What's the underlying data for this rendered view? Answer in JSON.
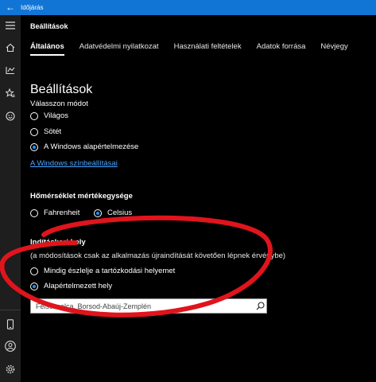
{
  "window": {
    "title": "Időjárás"
  },
  "header": {
    "title": "Beállítások"
  },
  "tabs": [
    {
      "label": "Általános"
    },
    {
      "label": "Adatvédelmi nyilatkozat"
    },
    {
      "label": "Használati feltételek"
    },
    {
      "label": "Adatok forrása"
    },
    {
      "label": "Névjegy"
    }
  ],
  "page": {
    "title": "Beállítások"
  },
  "mode": {
    "label": "Válasszon módot",
    "options": [
      {
        "label": "Világos",
        "checked": false
      },
      {
        "label": "Sötét",
        "checked": false
      },
      {
        "label": "A Windows alapértelmezése",
        "checked": true
      }
    ],
    "link": "A Windows színbeállításai"
  },
  "temperature": {
    "title": "Hőmérséklet mértékegysége",
    "options": [
      {
        "label": "Fahrenheit",
        "checked": false
      },
      {
        "label": "Celsius",
        "checked": true
      }
    ]
  },
  "launch": {
    "title": "Indításkori hely",
    "note": "(a módosítások csak az alkalmazás újraindítását követően lépnek érvénybe)",
    "options": [
      {
        "label": "Mindig észlelje a tartózkodási helyemet",
        "checked": false
      },
      {
        "label": "Alapértelmezett hely",
        "checked": true
      }
    ],
    "search_value": "Felsőzsolca, Borsod-Abaúj-Zemplén"
  },
  "rail": {
    "icons": [
      "hamburger-icon",
      "home-icon",
      "map-icon",
      "favorites-icon",
      "emoji-icon",
      "phone-icon",
      "account-icon",
      "settings-icon"
    ]
  },
  "colors": {
    "titlebar": "#1175d6",
    "accent": "#1e90ff",
    "annotation": "#e0141c"
  }
}
